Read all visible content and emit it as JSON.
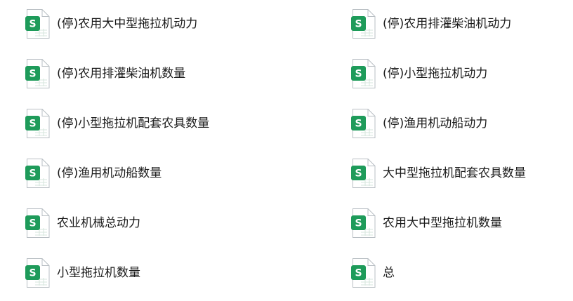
{
  "files": [
    {
      "name": "(停)农用大中型拖拉机动力",
      "icon": "spreadsheet-file-icon",
      "badge": "S"
    },
    {
      "name": "(停)农用排灌柴油机动力",
      "icon": "spreadsheet-file-icon",
      "badge": "S"
    },
    {
      "name": "(停)农用排灌柴油机数量",
      "icon": "spreadsheet-file-icon",
      "badge": "S"
    },
    {
      "name": "(停)小型拖拉机动力",
      "icon": "spreadsheet-file-icon",
      "badge": "S"
    },
    {
      "name": "(停)小型拖拉机配套农具数量",
      "icon": "spreadsheet-file-icon",
      "badge": "S"
    },
    {
      "name": "(停)渔用机动船动力",
      "icon": "spreadsheet-file-icon",
      "badge": "S"
    },
    {
      "name": "(停)渔用机动船数量",
      "icon": "spreadsheet-file-icon",
      "badge": "S"
    },
    {
      "name": "大中型拖拉机配套农具数量",
      "icon": "spreadsheet-file-icon",
      "badge": "S"
    },
    {
      "name": "农业机械总动力",
      "icon": "spreadsheet-file-icon",
      "badge": "S"
    },
    {
      "name": "农用大中型拖拉机数量",
      "icon": "spreadsheet-file-icon",
      "badge": "S"
    },
    {
      "name": "小型拖拉机数量",
      "icon": "spreadsheet-file-icon",
      "badge": "S"
    },
    {
      "name": "总",
      "icon": "spreadsheet-file-icon",
      "badge": "S"
    }
  ],
  "colors": {
    "badge": "#1e9b5a",
    "page_border": "#b9bfc4",
    "page_fill": "#ffffff",
    "grid_lines": "#d6e6dc"
  }
}
